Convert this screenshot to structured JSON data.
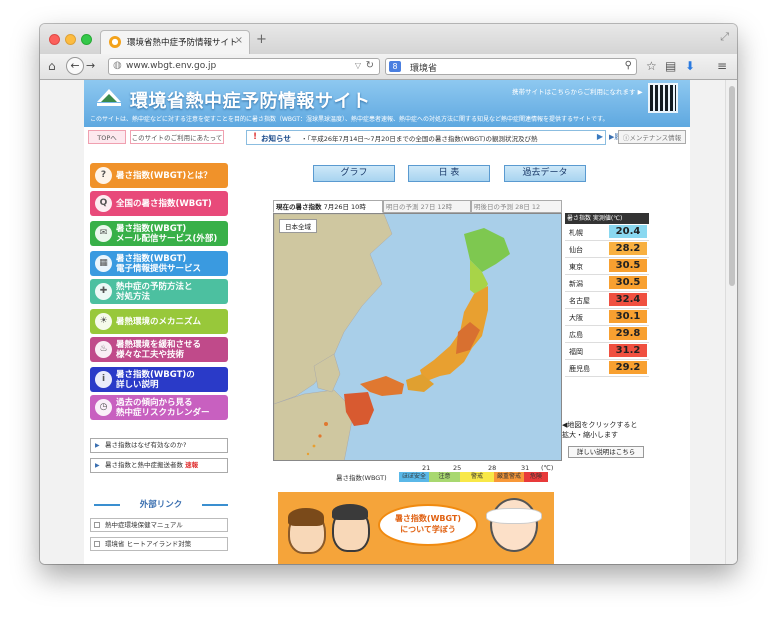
{
  "browser": {
    "tab_title": "環境省熱中症予防情報サイト",
    "url": "www.wbgt.env.go.jp",
    "search_text": "環境省"
  },
  "site": {
    "title": "環境省熱中症予防情報サイト",
    "mobile_note": "携帯サイトはこちらからご利用になれます ▶",
    "description": "このサイトは、熱中症などに対する注意を促すことを目的に暑さ指数（WBGT：湿球黒球温度）、熱中症患者速報、熱中症への対処方法に関する知見など熱中症関連情報を提供するサイトです。"
  },
  "subbar": {
    "top_label": "TOPへ",
    "use_label": "このサイトのご利用にあたって",
    "news_icon": "!",
    "news_label": "お知らせ",
    "news_text": "・「平成26年7月14日～7月20日までの全国の暑さ指数(WBGT)の観測状況及び熱",
    "history_label": "履歴",
    "maint_label": "メンテナンス情報"
  },
  "menu": [
    {
      "label": "暑さ指数(WBGT)とは？",
      "color": "#f0922a",
      "icon": "?"
    },
    {
      "label": "全国の暑さ指数(WBGT)",
      "color": "#e84a7a",
      "icon": "Q"
    },
    {
      "label": "暑さ指数(WBGT)\nメール配信サービス(外部)",
      "color": "#38b048",
      "icon": "✉"
    },
    {
      "label": "暑さ指数(WBGT)\n電子情報提供サービス",
      "color": "#3a9ae0",
      "icon": "▦"
    },
    {
      "label": "熱中症の予防方法と\n対処方法",
      "color": "#4cc0a0",
      "icon": "✚"
    },
    {
      "label": "暑熱環境のメカニズム",
      "color": "#98c83a",
      "icon": "☀"
    },
    {
      "label": "暑熱環境を緩和させる\n様々な工夫や技術",
      "color": "#c04a8a",
      "icon": "♨"
    },
    {
      "label": "暑さ指数(WBGT)の\n詳しい説明",
      "color": "#2a3ac8",
      "icon": "i"
    },
    {
      "label": "過去の傾向から見る\n熱中症リスクカレンダー",
      "color": "#c860c0",
      "icon": "◷"
    }
  ],
  "sublinks": [
    {
      "label": "暑さ指数はなぜ有効なのか?",
      "badge": ""
    },
    {
      "label": "暑さ指数と熱中症搬送者数",
      "badge": "速報"
    }
  ],
  "external": {
    "title": "外部リンク",
    "links": [
      "熱中症環境保健マニュアル",
      "環境省 ヒートアイランド対策"
    ]
  },
  "main_buttons": [
    "グラフ",
    "日 表",
    "過去データ"
  ],
  "map_tabs": [
    {
      "label": "現在の暑さ指数",
      "time": "7月26日 10時"
    },
    {
      "label": "明日の予測",
      "time": "27日 12時"
    },
    {
      "label": "明後日の予測",
      "time": "28日 12"
    }
  ],
  "map_region_label": "日本全域",
  "legend": {
    "label": "暑さ指数(WBGT)",
    "thresholds": [
      "21",
      "25",
      "28",
      "31",
      "(℃)"
    ],
    "levels": [
      {
        "label": "ほぼ安全",
        "color": "#5ab8e8"
      },
      {
        "label": "注意",
        "color": "#a8d870"
      },
      {
        "label": "警戒",
        "color": "#f8e848"
      },
      {
        "label": "厳重警戒",
        "color": "#f89838"
      },
      {
        "label": "危険",
        "color": "#e83a3a"
      }
    ]
  },
  "temp_table": {
    "header": "暑さ指数 実測値(℃)",
    "rows": [
      {
        "city": "札幌",
        "value": "20.4",
        "color": "#8ad8f0"
      },
      {
        "city": "仙台",
        "value": "28.2",
        "color": "#f8b040"
      },
      {
        "city": "東京",
        "value": "30.5",
        "color": "#f8a030"
      },
      {
        "city": "新潟",
        "value": "30.5",
        "color": "#f8a030"
      },
      {
        "city": "名古屋",
        "value": "32.4",
        "color": "#f05040"
      },
      {
        "city": "大阪",
        "value": "30.1",
        "color": "#f8a030"
      },
      {
        "city": "広島",
        "value": "29.8",
        "color": "#f8a030"
      },
      {
        "city": "福岡",
        "value": "31.2",
        "color": "#f05040"
      },
      {
        "city": "鹿児島",
        "value": "29.2",
        "color": "#f8a030"
      }
    ]
  },
  "map_note": "◀地図をクリックすると\n拡大・縮小します",
  "detail_button": "詳しい説明はこちら",
  "learn_banner": "暑さ指数(WBGT)\nについて学ぼう"
}
